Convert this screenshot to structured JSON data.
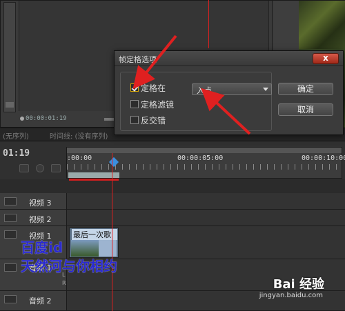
{
  "monitor": {
    "timecode": "00:00:01:19"
  },
  "tabs": [
    "(无序列)",
    "时间线: (没有序列)"
  ],
  "timeline": {
    "timecode": "01:19",
    "ruler_labels": [
      ":00:00",
      "00:00:05:00",
      "00:00:10:00"
    ],
    "tracks": [
      {
        "name": "视频 3"
      },
      {
        "name": "视频 2"
      },
      {
        "name": "视频 1"
      },
      {
        "name": "音频 1"
      },
      {
        "name": "音频 2"
      }
    ],
    "clip_title": "最后一次歌",
    "audio_lr": [
      "L",
      "R"
    ]
  },
  "dialog": {
    "title": "帧定格选项",
    "close_symbol": "x",
    "options": [
      {
        "label": "定格在",
        "checked": true
      },
      {
        "label": "定格滤镜",
        "checked": false
      },
      {
        "label": "反交错",
        "checked": false
      }
    ],
    "select_value": "入点",
    "ok_label": "确定",
    "cancel_label": "取消"
  },
  "overlay": {
    "line1": "百度id",
    "line2": "天然河与你相约"
  },
  "watermark": {
    "brand": "Bai 经验",
    "url": "jingyan.baidu.com"
  },
  "colors": {
    "annotation_red": "#e02020",
    "overlay_blue": "#2a2acf",
    "checkbox_accent": "#d7a400"
  }
}
